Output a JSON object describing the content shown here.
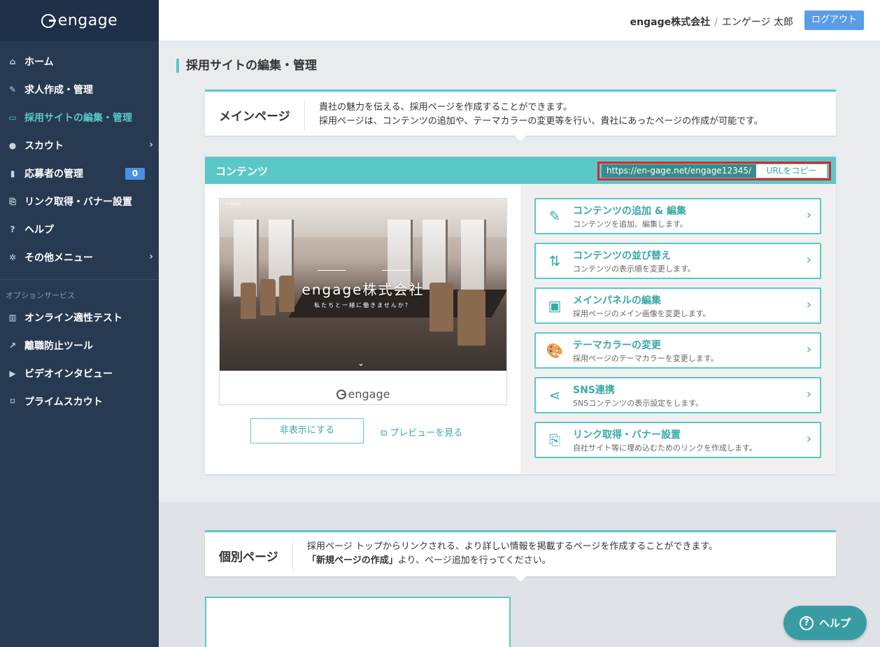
{
  "brand": {
    "logo_text": "engage"
  },
  "header": {
    "company": "engage株式会社",
    "separator": "/",
    "user": "エンゲージ 太郎",
    "logout_label": "ログアウト"
  },
  "sidebar": {
    "items": [
      {
        "label": "ホーム",
        "icon": "home-icon",
        "glyph": "⌂"
      },
      {
        "label": "求人作成・管理",
        "icon": "edit-icon",
        "glyph": "✎"
      },
      {
        "label": "採用サイトの編集・管理",
        "icon": "monitor-icon",
        "glyph": "▭",
        "active": true
      },
      {
        "label": "スカウト",
        "icon": "user-icon",
        "glyph": "●",
        "chevron": "›"
      },
      {
        "label": "応募者の管理",
        "icon": "id-card-icon",
        "glyph": "▮",
        "badge": "0"
      },
      {
        "label": "リンク取得・バナー設置",
        "icon": "code-file-icon",
        "glyph": "⎘"
      },
      {
        "label": "ヘルプ",
        "icon": "question-icon",
        "glyph": "?"
      },
      {
        "label": "その他メニュー",
        "icon": "gear-icon",
        "glyph": "✲",
        "chevron": "›"
      }
    ],
    "section_label": "オプションサービス",
    "option_items": [
      {
        "label": "オンライン適性テスト",
        "icon": "bar-chart-icon",
        "glyph": "▥"
      },
      {
        "label": "離職防止ツール",
        "icon": "line-chart-icon",
        "glyph": "↗"
      },
      {
        "label": "ビデオインタビュー",
        "icon": "video-icon",
        "glyph": "▶"
      },
      {
        "label": "プライムスカウト",
        "icon": "bookmark-icon",
        "glyph": "⌑"
      }
    ]
  },
  "main": {
    "page_title": "採用サイトの編集・管理",
    "main_page": {
      "label": "メインページ",
      "desc_line1": "貴社の魅力を伝える、採用ページを作成することができます。",
      "desc_line2": "採用ページは、コンテンツの追加や、テーマカラーの変更等を行い、貴社にあったページの作成が可能です。"
    },
    "contents": {
      "title": "コンテンツ",
      "url": "https://en-gage.net/engage12345/",
      "copy_label": "URLをコピー",
      "preview": {
        "company": "engage株式会社",
        "tagline": "私たちと一緒に働きませんか？",
        "footer_logo": "engage"
      },
      "hide_label": "非表示にする",
      "preview_link": "プレビューを見る",
      "actions": [
        {
          "title": "コンテンツの追加 & 編集",
          "sub": "コンテンツを追加、編集します。",
          "icon": "pencil-icon",
          "glyph": "✎"
        },
        {
          "title": "コンテンツの並び替え",
          "sub": "コンテンツの表示順を変更します。",
          "icon": "sort-icon",
          "glyph": "⇅"
        },
        {
          "title": "メインパネルの編集",
          "sub": "採用ページのメイン画像を変更します。",
          "icon": "image-panel-icon",
          "glyph": "▣"
        },
        {
          "title": "テーマカラーの変更",
          "sub": "採用ページのテーマカラーを変更します。",
          "icon": "palette-icon",
          "glyph": "🎨"
        },
        {
          "title": "SNS連携",
          "sub": "SNSコンテンツの表示設定をします。",
          "icon": "share-icon",
          "glyph": "⋖"
        },
        {
          "title": "リンク取得・バナー設置",
          "sub": "自社サイト等に埋め込むためのリンクを作成します。",
          "icon": "code-file-icon",
          "glyph": "⎘"
        }
      ]
    },
    "sub_page": {
      "label": "個別ページ",
      "desc_line1": "採用ページ トップからリンクされる、より詳しい情報を掲載するページを作成することができます。",
      "desc_line2_bold": "「新規ページの作成」",
      "desc_line2_rest": "より、ページ追加を行ってください。"
    }
  },
  "help_button": "ヘルプ",
  "colors": {
    "accent": "#5bc8c8",
    "sidebar": "#273a52",
    "highlight": "#e0242c",
    "logout": "#5a9de6"
  }
}
